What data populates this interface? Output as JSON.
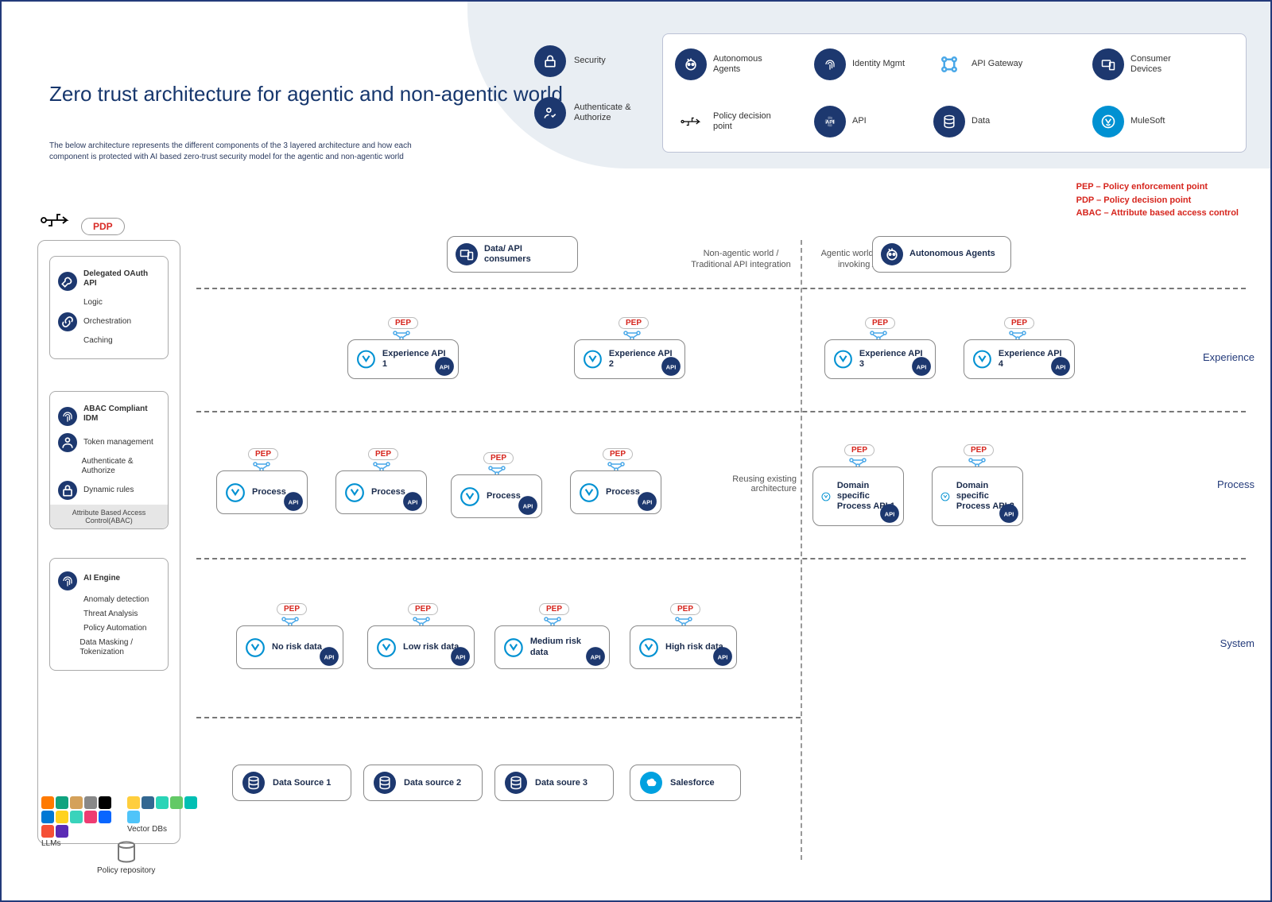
{
  "title": "Zero trust architecture for agentic and non-agentic world",
  "subtitle": "The below architecture represents the different components of the 3 layered architecture and how each component is protected with AI based zero-trust security model for the agentic and non-agentic world",
  "header_items": {
    "security": "Security",
    "auth": "Authenticate & Authorize"
  },
  "legend": {
    "auto": "Autonomous Agents",
    "idm": "Identity Mgmt",
    "gw": "API Gateway",
    "dev": "Consumer Devices",
    "pdp": "Policy decision point",
    "api": "API",
    "data": "Data",
    "mule": "MuleSoft"
  },
  "acro": {
    "pep": "PEP – Policy enforcement point",
    "pdp": "PDP – Policy decision point",
    "abac": "ABAC – Attribute based access control"
  },
  "pdp": "PDP",
  "pep": "PEP",
  "sidebar": {
    "oauth": {
      "title": "Delegated OAuth API",
      "i1": "Logic",
      "i2": "Orchestration",
      "i3": "Caching"
    },
    "idm": {
      "title": "ABAC Compliant IDM",
      "i1": "Token management",
      "i2": "Authenticate & Authorize",
      "i3": "Dynamic rules",
      "note": "Attribute Based Access Control(ABAC)"
    },
    "ai": {
      "title": "AI Engine",
      "i1": "Anomaly detection",
      "i2": "Threat Analysis",
      "i3": "Policy Automation",
      "i4": "Data Masking / Tokenization"
    }
  },
  "llms": "LLMs",
  "vectordbs": "Vector DBs",
  "repo": "Policy repository",
  "llm_brands": [
    "Mistral",
    "OpenAI",
    "Anthropic",
    "Gemini",
    "OpenAI",
    "Azure",
    "HF",
    "Cohere",
    "AI21labs",
    "Meta",
    "Groq",
    "Scale"
  ],
  "vdb_brands": [
    "Chroma",
    "pgvector",
    "Pinecone",
    "Weaviate",
    "elasticsearch",
    "Milvus"
  ],
  "worlds": {
    "left": "Non-agentic world / Traditional API integration",
    "right": "Agentic world / Agents invoking APIs"
  },
  "layers": {
    "exp": "Experience",
    "proc": "Process",
    "sys": "System"
  },
  "nodes": {
    "consumers": "Data/ API consumers",
    "agents": "Autonomous Agents",
    "exp1": "Experience API 1",
    "exp2": "Experience API 2",
    "exp3": "Experience API 3",
    "exp4": "Experience API 4",
    "proc": "Process",
    "dproc1": "Domain specific Process API 1",
    "dproc2": "Domain specific Process API 2",
    "norisk": "No risk data",
    "low": "Low risk data",
    "med": "Medium risk data",
    "high": "High risk data",
    "ds1": "Data Source 1",
    "ds2": "Data source 2",
    "ds3": "Data soure 3",
    "sf": "Salesforce"
  },
  "ann": {
    "reuse": "Reusing existing architecture"
  }
}
